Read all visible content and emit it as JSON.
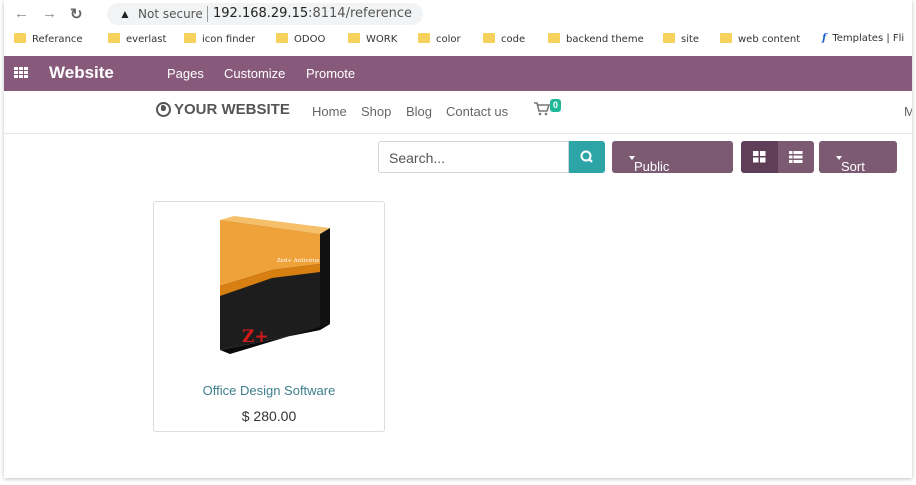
{
  "browser": {
    "not_secure": "Not secure",
    "url_host": "192.168.29.15",
    "url_rest": ":8114/reference",
    "bookmarks": [
      {
        "label": "Referance",
        "icon": "folder-icon"
      },
      {
        "label": "everlast",
        "icon": "folder-icon"
      },
      {
        "label": "icon finder",
        "icon": "folder-icon"
      },
      {
        "label": "ODOO",
        "icon": "folder-icon"
      },
      {
        "label": "WORK",
        "icon": "folder-icon"
      },
      {
        "label": "color",
        "icon": "folder-icon"
      },
      {
        "label": "code",
        "icon": "folder-icon"
      },
      {
        "label": "backend theme",
        "icon": "folder-icon"
      },
      {
        "label": "site",
        "icon": "folder-icon"
      },
      {
        "label": "web content",
        "icon": "folder-icon"
      },
      {
        "label": "Templates | Fli",
        "icon": "facebook-icon"
      }
    ]
  },
  "odoo_nav": {
    "brand": "Website",
    "menu": [
      "Pages",
      "Customize",
      "Promote"
    ]
  },
  "site": {
    "logo": "YOUR WEBSITE",
    "nav": [
      "Home",
      "Shop",
      "Blog",
      "Contact us"
    ],
    "cart_count": "0",
    "right_truncated": "M"
  },
  "toolbar": {
    "search_placeholder": "Search...",
    "pricelist": "Public Pricelist",
    "sort": "Sort by"
  },
  "product": {
    "name": "Office Design Software",
    "price": "$ 280.00",
    "box_label": "Zed+ Antivirus",
    "box_logo": "Z+"
  },
  "colors": {
    "odoo_purple": "#875a7b",
    "button_purple": "#7b5a72",
    "search_teal": "#2da5a6",
    "cart_badge": "#21b799"
  }
}
